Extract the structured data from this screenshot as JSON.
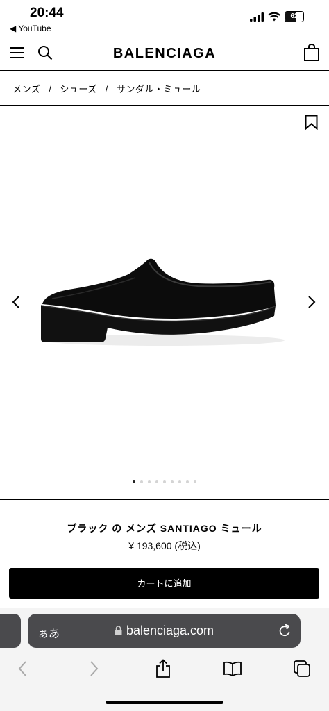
{
  "status": {
    "time": "20:44",
    "back_app": "◀ YouTube",
    "battery": "62"
  },
  "header": {
    "logo": "BALENCIAGA"
  },
  "breadcrumb": {
    "items": [
      "メンズ",
      "シューズ",
      "サンダル・ミュール"
    ],
    "separator": "/"
  },
  "gallery": {
    "dot_count": 9,
    "active_index": 0
  },
  "product": {
    "title": "ブラック の メンズ SANTIAGO ミュール",
    "price": "¥ 193,600 (税込)"
  },
  "cta": {
    "add_to_cart": "カートに追加"
  },
  "safari": {
    "aa_label": "ぁあ",
    "url": "balenciaga.com"
  },
  "icons": [
    "menu-icon",
    "search-icon",
    "bag-icon",
    "bookmark-icon",
    "chevron-left-icon",
    "chevron-right-icon",
    "lock-icon",
    "reload-icon",
    "share-icon",
    "book-icon",
    "tabs-icon"
  ]
}
